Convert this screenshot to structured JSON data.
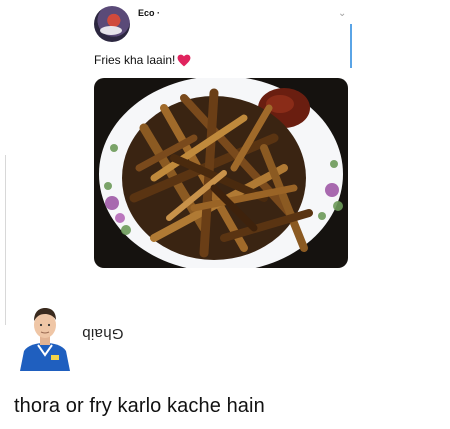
{
  "tweet": {
    "author": "Eco ·",
    "text": "Fries kha laain!",
    "image_alt": "plate of fries",
    "chevron_icon": "chevron-down-icon",
    "heart_icon": "heart-icon"
  },
  "reply": {
    "name": "Ghaib",
    "text": "thora or fry karlo kache hain"
  },
  "colors": {
    "heart": "#e0245e",
    "scroll_accent": "#5aa4e6",
    "jersey": "#1f5fbf"
  }
}
